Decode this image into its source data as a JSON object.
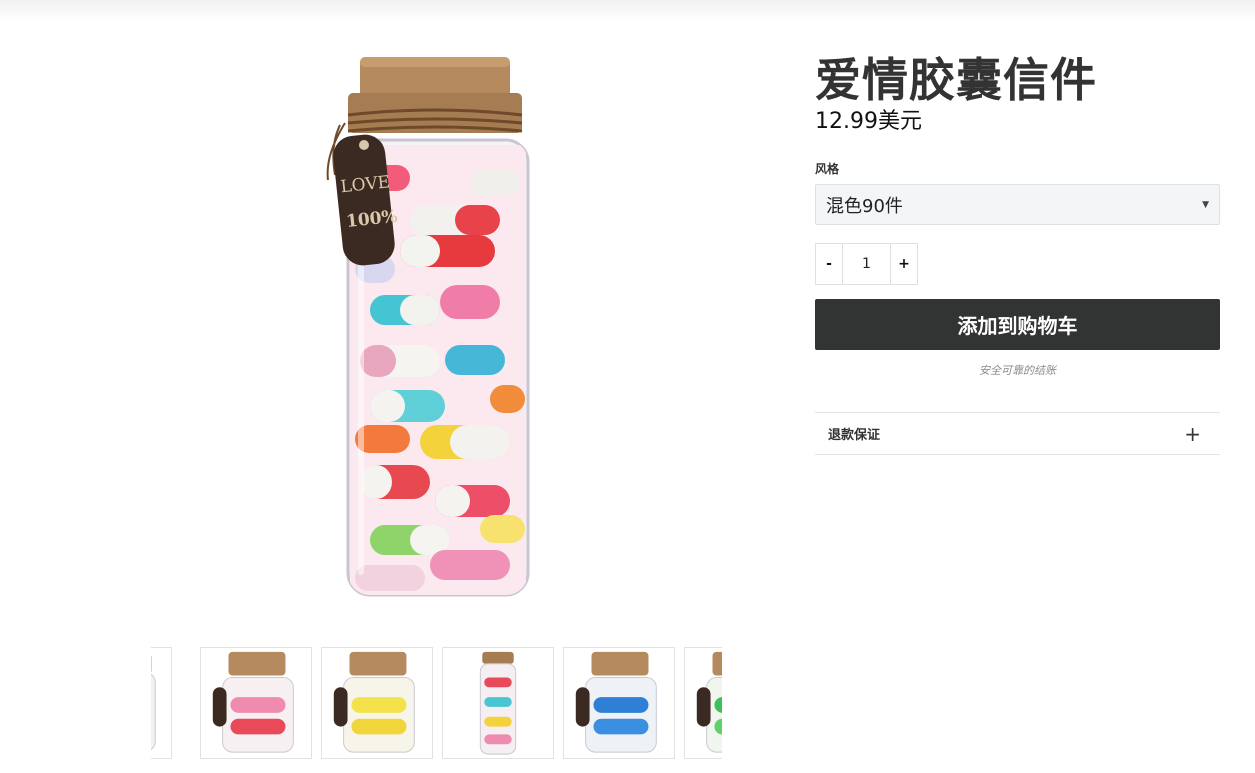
{
  "product": {
    "title": "爱情胶囊信件",
    "price": "12.99美元",
    "tag_text_1": "LOVE",
    "tag_text_2": "100%"
  },
  "variant": {
    "label": "风格",
    "selected": "混色90件"
  },
  "quantity": {
    "minus_label": "-",
    "value": "1",
    "plus_label": "+"
  },
  "cart": {
    "add_label": "添加到购物车",
    "secure_text": "安全可靠的结账"
  },
  "accordion": {
    "label": "退款保证",
    "icon": "plus-icon"
  },
  "thumbnails": [
    "cyan-capsule-jar",
    "pink-capsule-jar",
    "yellow-capsule-jar",
    "tall-mixed-capsule-jar",
    "blue-capsule-jar",
    "green-capsule-jar"
  ]
}
